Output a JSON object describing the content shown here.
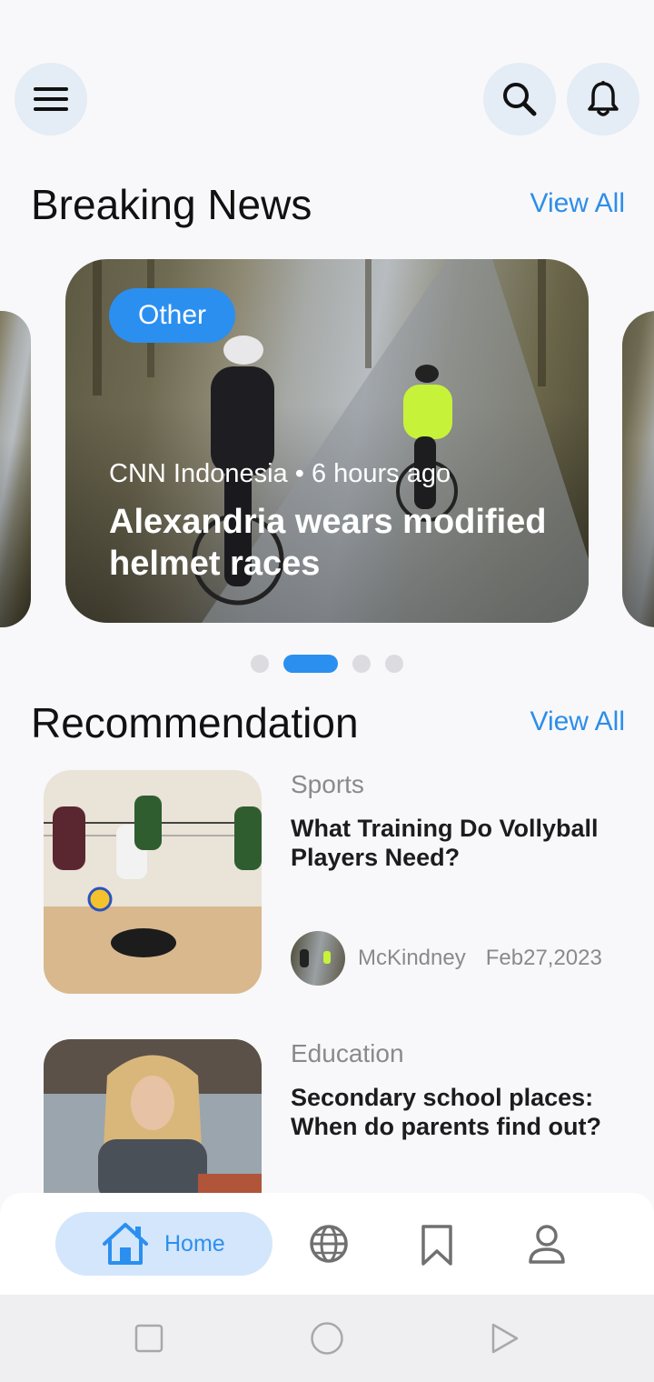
{
  "header": {
    "menu_icon": "hamburger-menu-icon",
    "search_icon": "search-icon",
    "notification_icon": "bell-icon"
  },
  "breaking": {
    "title": "Breaking News",
    "view_all": "View All",
    "card": {
      "category": "Other",
      "source": "CNN Indonesia",
      "separator": "•",
      "time": "6 hours ago",
      "headline": "Alexandria wears modified helmet races"
    },
    "carousel_total": 4,
    "carousel_active_index": 1
  },
  "recommendation": {
    "title": "Recommendation",
    "view_all": "View All",
    "items": [
      {
        "category": "Sports",
        "title": "What Training Do Vollyball Players Need?",
        "author": "McKindney",
        "date": "Feb27,2023"
      },
      {
        "category": "Education",
        "title": "Secondary school places: When do parents find out?"
      }
    ]
  },
  "bottom_nav": {
    "home_label": "Home",
    "icons": [
      "home-icon",
      "globe-icon",
      "bookmark-icon",
      "profile-icon"
    ]
  },
  "colors": {
    "accent": "#2b8ff0",
    "button_bg": "#e4ecf5",
    "home_pill_bg": "#d4e6fb"
  }
}
